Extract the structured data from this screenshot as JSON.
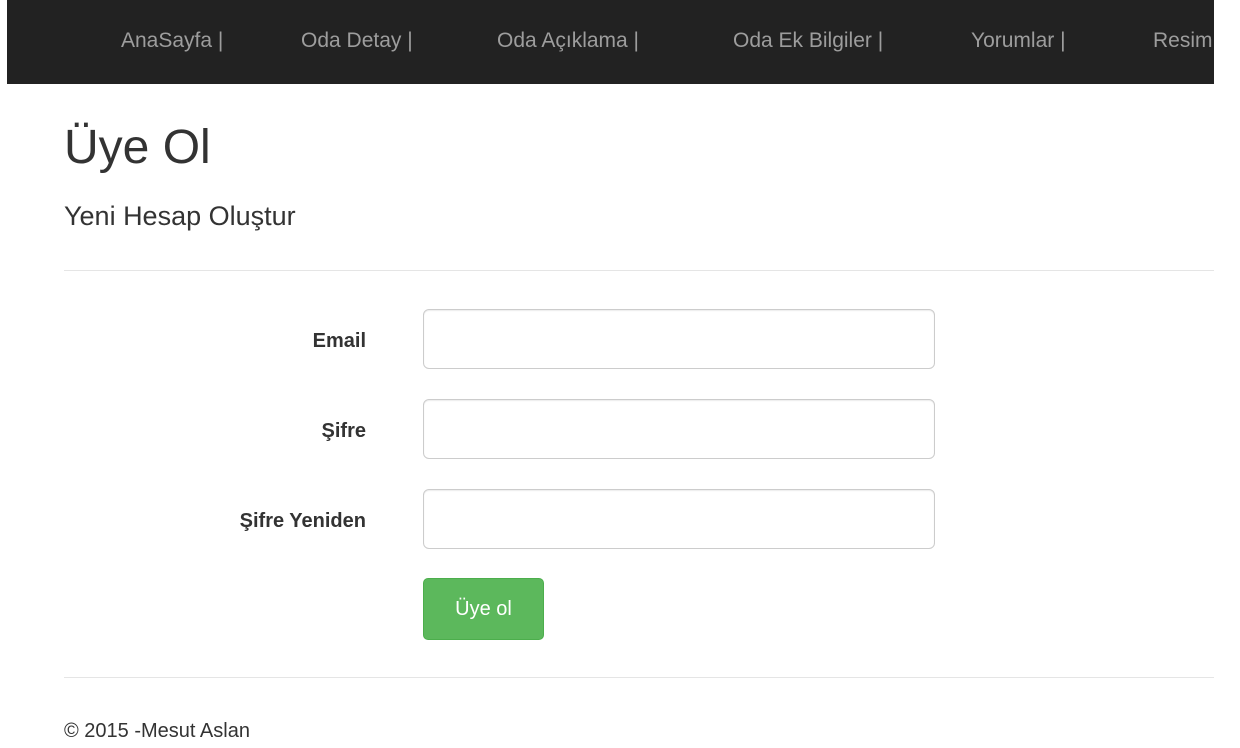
{
  "navbar": {
    "items": [
      {
        "label": "AnaSayfa |"
      },
      {
        "label": "Oda Detay |"
      },
      {
        "label": "Oda Açıklama |"
      },
      {
        "label": "Oda Ek Bilgiler |"
      },
      {
        "label": "Yorumlar |"
      },
      {
        "label": "Resim"
      }
    ]
  },
  "main": {
    "title": "Üye Ol",
    "subtitle": "Yeni Hesap Oluştur",
    "form": {
      "email_label": "Email",
      "email_value": "",
      "password_label": "Şifre",
      "password_value": "",
      "password_confirm_label": "Şifre Yeniden",
      "password_confirm_value": "",
      "submit_label": "Üye ol"
    }
  },
  "footer": {
    "text": "© 2015 -Mesut Aslan"
  },
  "colors": {
    "navbar_bg": "#222222",
    "nav_text": "#9d9d9d",
    "submit_bg": "#5cb85c"
  }
}
